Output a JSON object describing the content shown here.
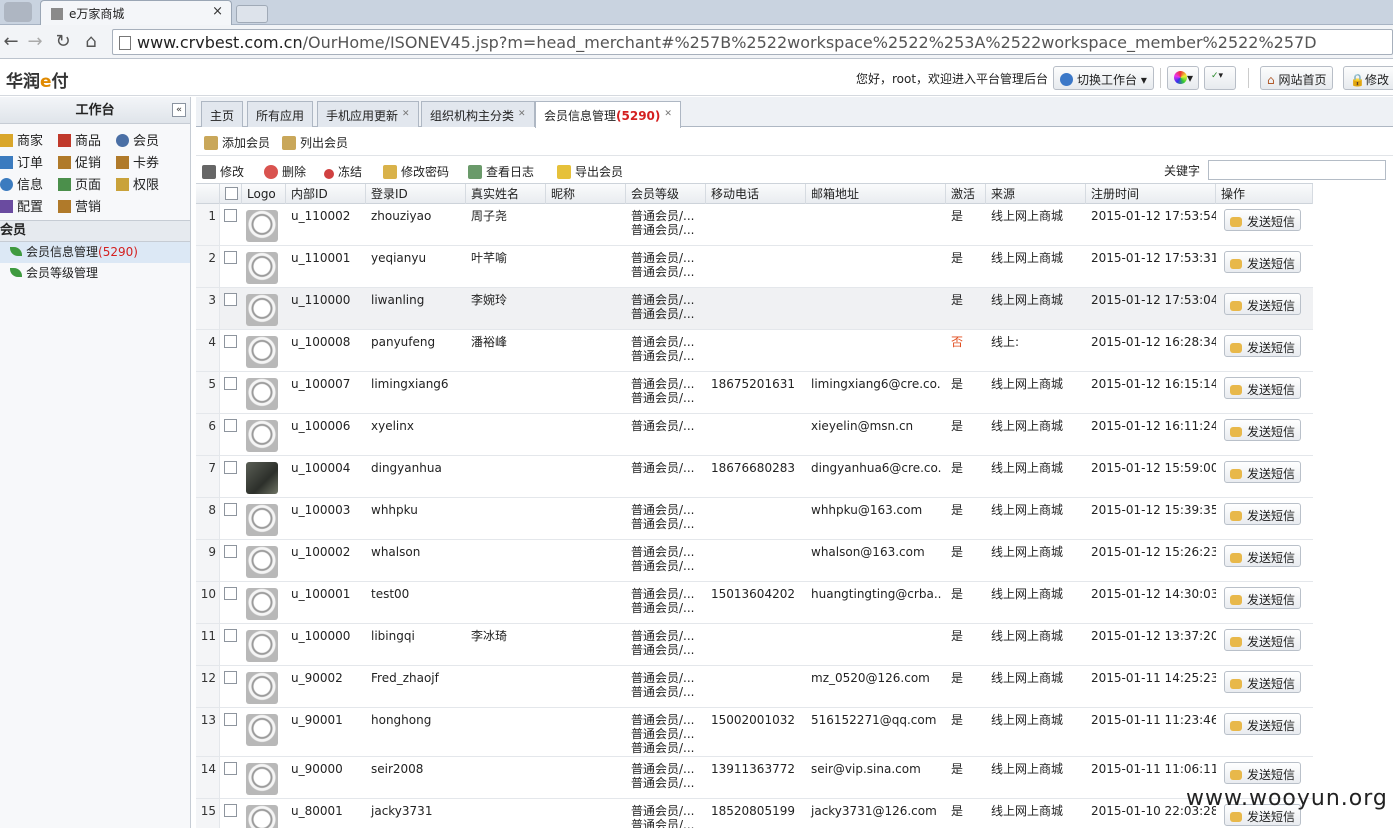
{
  "browser": {
    "tab_title": "e万家商城",
    "tab_close": "×",
    "url_host": "www.crvbest.com.cn",
    "url_path": "/OurHome/ISONEV45.jsp?m=head_merchant#%257B%2522workspace%2522%253A%2522workspace_member%2522%257D"
  },
  "header": {
    "logo_main": "华润",
    "logo_e": "e",
    "logo_tail": "付",
    "greeting": "您好，root，欢迎进入平台管理后台",
    "switch_workspace": "切换工作台",
    "site_home": "网站首页",
    "modify": "修改"
  },
  "sidebar": {
    "title": "工作台",
    "collapse": "«",
    "grid": [
      {
        "label": "商家",
        "color": "#d9a62b"
      },
      {
        "label": "商品",
        "color": "#c0392b"
      },
      {
        "label": "会员",
        "color": "#4a6fa5"
      },
      {
        "label": "订单",
        "color": "#3b7bbf"
      },
      {
        "label": "促销",
        "color": "#b07a2a"
      },
      {
        "label": "卡券",
        "color": "#b07a2a"
      },
      {
        "label": "信息",
        "color": "#3b7bbf"
      },
      {
        "label": "页面",
        "color": "#4b8f4b"
      },
      {
        "label": "权限",
        "color": "#c9a23a"
      },
      {
        "label": "配置",
        "color": "#6a4ba0"
      },
      {
        "label": "营销",
        "color": "#b07a2a"
      }
    ],
    "section": "会员",
    "menu": [
      {
        "label": "会员信息管理",
        "count": "(5290)"
      },
      {
        "label": "会员等级管理",
        "count": ""
      }
    ]
  },
  "tabs": [
    {
      "label": "主页",
      "count": "",
      "close": ""
    },
    {
      "label": "所有应用",
      "count": "",
      "close": ""
    },
    {
      "label": "手机应用更新",
      "count": "",
      "close": "✕"
    },
    {
      "label": "组织机构主分类",
      "count": "",
      "close": "✕"
    },
    {
      "label": "会员信息管理",
      "count": "(5290)",
      "close": "✕"
    }
  ],
  "toolbar1": {
    "add": "添加会员",
    "list": "列出会员"
  },
  "toolbar2": {
    "edit": "修改",
    "delete": "删除",
    "freeze": "冻结",
    "password": "修改密码",
    "log": "查看日志",
    "export": "导出会员",
    "keyword_label": "关键字"
  },
  "columns": [
    "Logo",
    "内部ID",
    "登录ID",
    "真实姓名",
    "昵称",
    "会员等级",
    "移动电话",
    "邮箱地址",
    "激活",
    "来源",
    "注册时间",
    "操作"
  ],
  "rows": [
    {
      "n": "1",
      "id": "u_110002",
      "login": "zhouziyao",
      "name": "周子尧",
      "level": [
        "普通会员/...",
        "普通会员/..."
      ],
      "phone": "",
      "email": "",
      "active": "是",
      "source": "线上网上商城",
      "time": "2015-01-12 17:53:54",
      "photo": false
    },
    {
      "n": "2",
      "id": "u_110001",
      "login": "yeqianyu",
      "name": "叶芊喻",
      "level": [
        "普通会员/...",
        "普通会员/..."
      ],
      "phone": "",
      "email": "",
      "active": "是",
      "source": "线上网上商城",
      "time": "2015-01-12 17:53:31",
      "photo": false
    },
    {
      "n": "3",
      "id": "u_110000",
      "login": "liwanling",
      "name": "李婉玲",
      "level": [
        "普通会员/...",
        "普通会员/..."
      ],
      "phone": "",
      "email": "",
      "active": "是",
      "source": "线上网上商城",
      "time": "2015-01-12 17:53:04",
      "photo": false
    },
    {
      "n": "4",
      "id": "u_100008",
      "login": "panyufeng",
      "name": "潘裕峰",
      "level": [
        "普通会员/...",
        "普通会员/..."
      ],
      "phone": "",
      "email": "",
      "active": "否",
      "source": "线上:",
      "time": "2015-01-12 16:28:34",
      "photo": false
    },
    {
      "n": "5",
      "id": "u_100007",
      "login": "limingxiang6",
      "name": "",
      "level": [
        "普通会员/...",
        "普通会员/..."
      ],
      "phone": "18675201631",
      "email": "limingxiang6@cre.co...",
      "active": "是",
      "source": "线上网上商城",
      "time": "2015-01-12 16:15:14",
      "photo": false
    },
    {
      "n": "6",
      "id": "u_100006",
      "login": "xyelinx",
      "name": "",
      "level": [
        "普通会员/..."
      ],
      "phone": "",
      "email": "xieyelin@msn.cn",
      "active": "是",
      "source": "线上网上商城",
      "time": "2015-01-12 16:11:24",
      "photo": false
    },
    {
      "n": "7",
      "id": "u_100004",
      "login": "dingyanhua",
      "name": "",
      "level": [
        "普通会员/..."
      ],
      "phone": "18676680283",
      "email": "dingyanhua6@cre.co...",
      "active": "是",
      "source": "线上网上商城",
      "time": "2015-01-12 15:59:00",
      "photo": true
    },
    {
      "n": "8",
      "id": "u_100003",
      "login": "whhpku",
      "name": "",
      "level": [
        "普通会员/...",
        "普通会员/..."
      ],
      "phone": "",
      "email": "whhpku@163.com",
      "active": "是",
      "source": "线上网上商城",
      "time": "2015-01-12 15:39:35",
      "photo": false
    },
    {
      "n": "9",
      "id": "u_100002",
      "login": "whalson",
      "name": "",
      "level": [
        "普通会员/...",
        "普通会员/..."
      ],
      "phone": "",
      "email": "whalson@163.com",
      "active": "是",
      "source": "线上网上商城",
      "time": "2015-01-12 15:26:23",
      "photo": false
    },
    {
      "n": "10",
      "id": "u_100001",
      "login": "test00",
      "name": "",
      "level": [
        "普通会员/...",
        "普通会员/..."
      ],
      "phone": "15013604202",
      "email": "huangtingting@crba...",
      "active": "是",
      "source": "线上网上商城",
      "time": "2015-01-12 14:30:03",
      "photo": false
    },
    {
      "n": "11",
      "id": "u_100000",
      "login": "libingqi",
      "name": "李冰琦",
      "level": [
        "普通会员/...",
        "普通会员/..."
      ],
      "phone": "",
      "email": "",
      "active": "是",
      "source": "线上网上商城",
      "time": "2015-01-12 13:37:20",
      "photo": false
    },
    {
      "n": "12",
      "id": "u_90002",
      "login": "Fred_zhaojf",
      "name": "",
      "level": [
        "普通会员/...",
        "普通会员/..."
      ],
      "phone": "",
      "email": "mz_0520@126.com",
      "active": "是",
      "source": "线上网上商城",
      "time": "2015-01-11 14:25:23",
      "photo": false
    },
    {
      "n": "13",
      "id": "u_90001",
      "login": "honghong",
      "name": "",
      "level": [
        "普通会员/...",
        "普通会员/...",
        "普通会员/..."
      ],
      "phone": "15002001032",
      "email": "516152271@qq.com",
      "active": "是",
      "source": "线上网上商城",
      "time": "2015-01-11 11:23:46",
      "photo": false
    },
    {
      "n": "14",
      "id": "u_90000",
      "login": "seir2008",
      "name": "",
      "level": [
        "普通会员/...",
        "普通会员/..."
      ],
      "phone": "13911363772",
      "email": "seir@vip.sina.com",
      "active": "是",
      "source": "线上网上商城",
      "time": "2015-01-11 11:06:11",
      "photo": false
    },
    {
      "n": "15",
      "id": "u_80001",
      "login": "jacky3731",
      "name": "",
      "level": [
        "普通会员/...",
        "普通会员/..."
      ],
      "phone": "18520805199",
      "email": "jacky3731@126.com",
      "active": "是",
      "source": "线上网上商城",
      "time": "2015-01-10 22:03:28",
      "photo": false
    }
  ],
  "sms_label": "发送短信",
  "watermark": "www.wooyun.org",
  "colors": {
    "accent_red": "#d42020",
    "inactive": "#e04b1c",
    "highlight_row": "#f0f1f3"
  }
}
